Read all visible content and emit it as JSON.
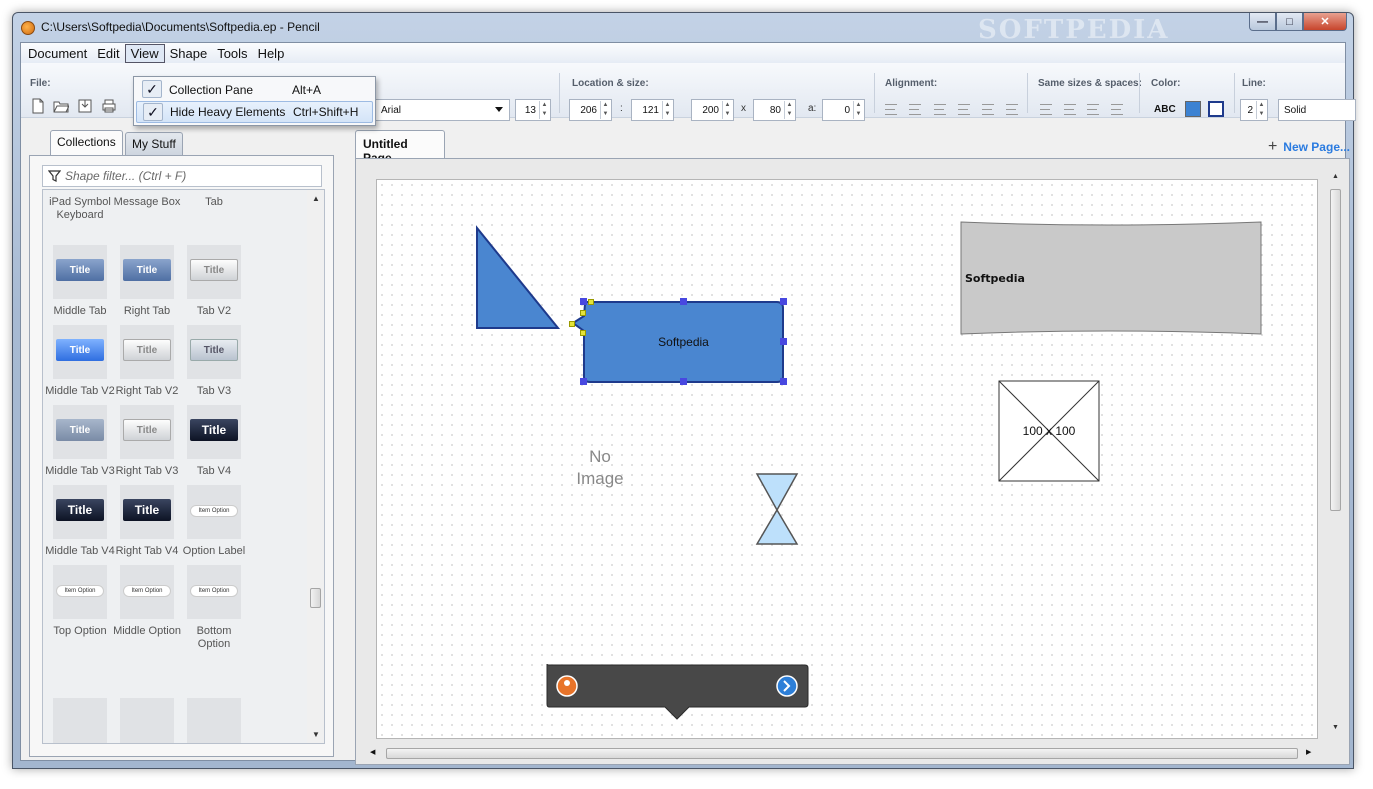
{
  "window": {
    "title": "C:\\Users\\Softpedia\\Documents\\Softpedia.ep - Pencil",
    "watermark": "SOFTPEDIA",
    "buttons": {
      "minimize": "—",
      "maximize": "□",
      "close": "✕"
    }
  },
  "menu": [
    "Document",
    "Edit",
    "View",
    "Shape",
    "Tools",
    "Help"
  ],
  "view_dropdown": [
    {
      "label": "Collection Pane",
      "shortcut": "Alt+A",
      "checked": true
    },
    {
      "label": "Hide Heavy Elements",
      "shortcut": "Ctrl+Shift+H",
      "checked": true
    }
  ],
  "toolbar": {
    "file_label": "File:",
    "font_name": "Arial",
    "font_size": "13",
    "location_label": "Location & size:",
    "loc_x": "206",
    "loc_colon": ":",
    "loc_y": "121",
    "width": "200",
    "times": "x",
    "height": "80",
    "angle_label": "a:",
    "angle": "0",
    "alignment_label": "Alignment:",
    "same_label": "Same sizes & spaces:",
    "color_label": "Color:",
    "color_text": "ABC",
    "line_label": "Line:",
    "line_width": "2",
    "line_style": "Solid",
    "fill_color": "#3c82d2",
    "stroke_color": "#1e3a8c"
  },
  "left_panel": {
    "tabs": [
      "Collections",
      "My Stuff"
    ],
    "filter_placeholder": "Shape filter... (Ctrl + F)",
    "top_labels": [
      "iPad Symbol Keyboard",
      "Message Box",
      "Tab"
    ],
    "shapes": [
      {
        "label": "Middle Tab",
        "thumb": "Title",
        "style": "blue"
      },
      {
        "label": "Right Tab",
        "thumb": "Title",
        "style": "blue"
      },
      {
        "label": "Tab V2",
        "thumb": "Title",
        "style": "silver"
      },
      {
        "label": "Middle Tab V2",
        "thumb": "Title",
        "style": "bright"
      },
      {
        "label": "Right Tab V2",
        "thumb": "Title",
        "style": "silver"
      },
      {
        "label": "Tab V3",
        "thumb": "Title",
        "style": "lightgrey"
      },
      {
        "label": "Middle Tab V3",
        "thumb": "Title",
        "style": "steel"
      },
      {
        "label": "Right Tab V3",
        "thumb": "Title",
        "style": "silver"
      },
      {
        "label": "Tab V4",
        "thumb": "Title",
        "style": "dark"
      },
      {
        "label": "Middle Tab V4",
        "thumb": "Title",
        "style": "dark"
      },
      {
        "label": "Right Tab V4",
        "thumb": "Title",
        "style": "dark"
      },
      {
        "label": "Option Label",
        "thumb": "Item  Option",
        "style": "option"
      },
      {
        "label": "Top Option",
        "thumb": "Item  Option",
        "style": "option"
      },
      {
        "label": "Middle Option",
        "thumb": "Item  Option",
        "style": "option"
      },
      {
        "label": "Bottom Option",
        "thumb": "Item  Option",
        "style": "option"
      }
    ]
  },
  "page": {
    "tab_title": "Untitled Page",
    "new_page": "New Page...",
    "rect_text": "Softpedia",
    "gray_text": "Softpedia",
    "no_image": "No Image",
    "image_placeholder": "100 x 100"
  }
}
